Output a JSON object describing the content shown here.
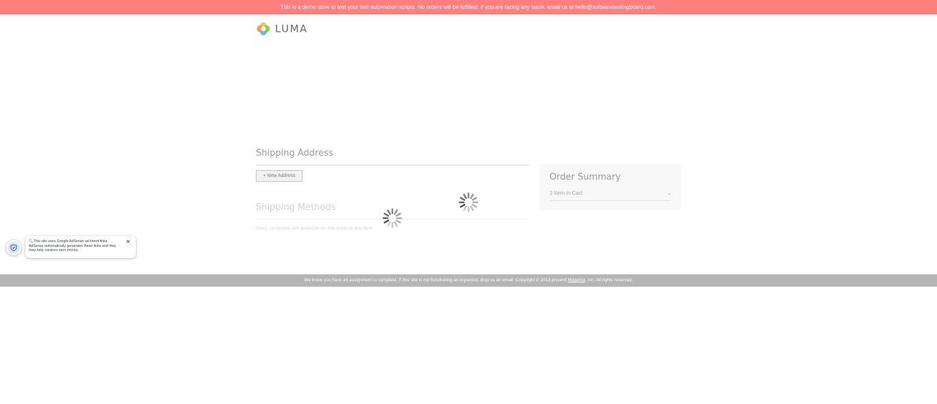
{
  "banner": {
    "text": "This is a demo store to test your test automation scripts. No orders will be fulfilled. If you are facing any issue, email us at hello@softwaretestingboard.com."
  },
  "logo": {
    "text": "LUMA"
  },
  "shipping": {
    "title": "Shipping Address",
    "new_address_label": "+ New Address"
  },
  "methods": {
    "title": "Shipping Methods",
    "note": "Sorry, no quotes are available for this order at this time"
  },
  "summary": {
    "title": "Order Summary",
    "items_label": "2 Item in Cart"
  },
  "adsense": {
    "text": "This site uses Google AdSense ad intent links. AdSense automatically generates these links and they may help creators earn money."
  },
  "footer": {
    "text_before": "We know you have an assignment to complete. If this site is not functioning as expected, drop us an email. Copyright © 2013-present ",
    "link": "Magento",
    "text_after": ", Inc. All rights reserved."
  },
  "colors": {
    "banner_bg": "#ff7f7f",
    "footer_bg": "#b5b5b5",
    "summary_bg": "#f8f8f8"
  },
  "icons": [
    "luma-logo-icon",
    "loading-spinner-icon",
    "shield-icon",
    "close-icon",
    "chevron-down-icon",
    "magnifier-icon"
  ]
}
